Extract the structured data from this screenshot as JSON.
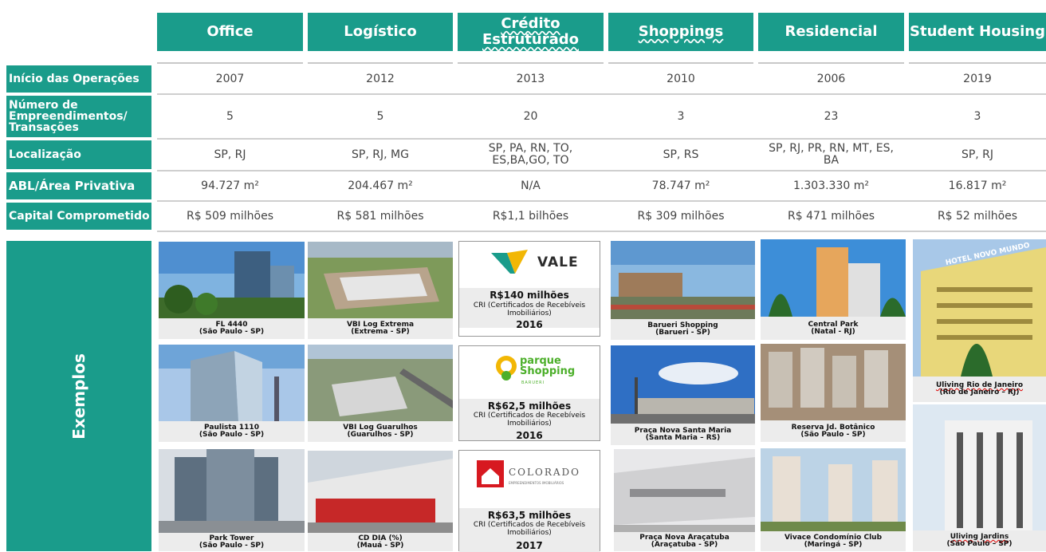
{
  "columns": [
    "Office",
    "Logístico",
    "Crédito Estruturado",
    "Shoppings",
    "Residencial",
    "Student Housing"
  ],
  "rows": [
    {
      "label": "Início das Operações",
      "values": [
        "2007",
        "2012",
        "2013",
        "2010",
        "2006",
        "2019"
      ]
    },
    {
      "label": "Número de Empreendimentos/ Transações",
      "values": [
        "5",
        "5",
        "20",
        "3",
        "23",
        "3"
      ]
    },
    {
      "label": "Localização",
      "values": [
        "SP, RJ",
        "SP, RJ, MG",
        "SP, PA, RN, TO, ES,BA,GO, TO",
        "SP, RS",
        "SP, RJ, PR, RN, MT, ES, BA",
        "SP, RJ"
      ]
    },
    {
      "label": "ABL/Área Privativa",
      "values": [
        "94.727 m²",
        "204.467 m²",
        "N/A",
        "78.747 m²",
        "1.303.330 m²",
        "16.817 m²"
      ]
    },
    {
      "label": "Capital Comprometido",
      "values": [
        "R$ 509 milhões",
        "R$ 581 milhões",
        "R$1,1 bilhões",
        "R$ 309 milhões",
        "R$ 471 milhões",
        "R$ 52 milhões"
      ]
    }
  ],
  "examples_label": "Exemplos",
  "office": [
    {
      "name": "FL 4440",
      "loc": "(São Paulo - SP)"
    },
    {
      "name": "Paulista 1110",
      "loc": "(São Paulo - SP)"
    },
    {
      "name": "Park Tower",
      "loc": "(São Paulo - SP)"
    }
  ],
  "logistico": [
    {
      "name": "VBI Log Extrema",
      "loc": "(Extrema  - SP)"
    },
    {
      "name": "VBI Log Guarulhos",
      "loc": "(Guarulhos  - SP)"
    },
    {
      "name": "CD DIA (%)",
      "loc": "(Mauá - SP)"
    }
  ],
  "credito": [
    {
      "logo": "VALE",
      "amount": "R$140 milhões",
      "desc": "CRI (Certificados de Recebíveis Imobiliários)",
      "year": "2016"
    },
    {
      "logo": "parque Shopping",
      "logo_sub": "BARUERI",
      "amount": "R$62,5 milhões",
      "desc": "CRI (Certificados de Recebíveis Imobiliários)",
      "year": "2016"
    },
    {
      "logo": "COLORADO",
      "logo_sub": "EMPREENDIMENTOS IMOBILIÁRIOS",
      "amount": "R$63,5 milhões",
      "desc": "CRI (Certificados de Recebíveis Imobiliários)",
      "year": "2017"
    }
  ],
  "shoppings": [
    {
      "name": "Barueri Shopping",
      "loc": "(Barueri - SP)"
    },
    {
      "name": "Praça Nova Santa Maria",
      "loc": "(Santa Maria – RS)"
    },
    {
      "name": "Praça Nova Araçatuba",
      "loc": "(Araçatuba - SP)"
    }
  ],
  "residencial": [
    {
      "name": "Central Park",
      "loc": "(Natal - RJ)"
    },
    {
      "name": "Reserva Jd. Botânico",
      "loc": "(São Paulo - SP)"
    },
    {
      "name": "Vivace Condomínio Club",
      "loc": "(Maringá - SP)"
    }
  ],
  "student": [
    {
      "name": "Uliving Rio de Janeiro",
      "loc": "(Rio de Janeiro – RJ)",
      "sign": "HOTEL NOVO MUNDO"
    },
    {
      "name": "Uliving Jardins",
      "loc": "(São Paulo – SP)"
    }
  ],
  "colors": {
    "teal": "#1a9c8b",
    "vale_green": "#1a9c8b",
    "vale_yellow": "#f2b705",
    "parque_green": "#4caf2a",
    "colorado_red": "#d71920"
  }
}
